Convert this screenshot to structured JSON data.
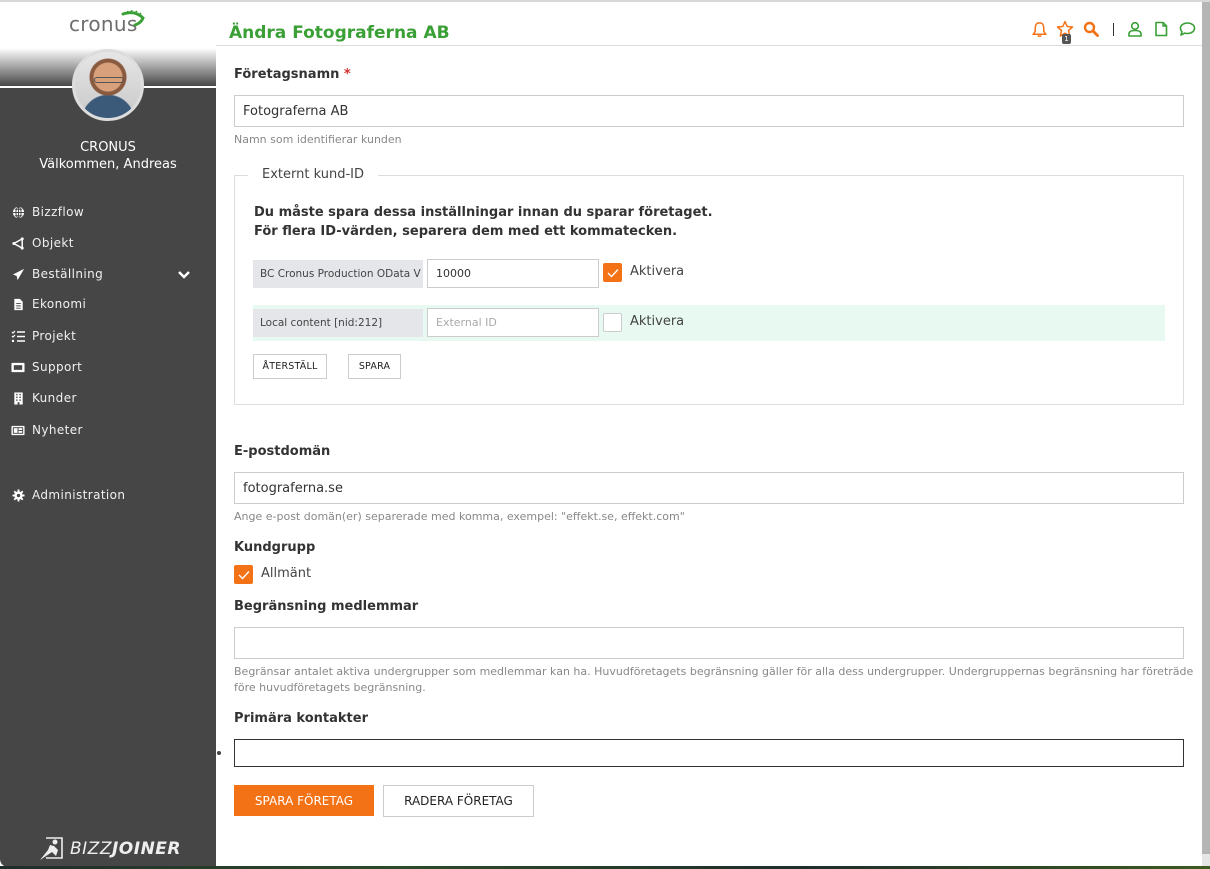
{
  "brand": {
    "logo_text": "cronus",
    "footer_logo_prefix": "BIZZ",
    "footer_logo_suffix": "JOINER"
  },
  "user": {
    "organization": "CRONUS",
    "welcome": "Välkommen, Andreas"
  },
  "sidebar": {
    "items": [
      {
        "label": "Bizzflow",
        "icon": "globe-icon"
      },
      {
        "label": "Objekt",
        "icon": "objects-icon"
      },
      {
        "label": "Beställning",
        "icon": "paper-plane-icon",
        "expandable": true
      },
      {
        "label": "Ekonomi",
        "icon": "document-icon"
      },
      {
        "label": "Projekt",
        "icon": "tasks-icon"
      },
      {
        "label": "Support",
        "icon": "ticket-icon"
      },
      {
        "label": "Kunder",
        "icon": "building-icon"
      },
      {
        "label": "Nyheter",
        "icon": "newspaper-icon"
      },
      {
        "label": "Administration",
        "icon": "gear-icon"
      }
    ]
  },
  "header": {
    "title": "Ändra Fotograferna AB",
    "favorites_badge": "1",
    "icons": [
      "bell-icon",
      "star-icon",
      "search-icon",
      "user-icon",
      "file-icon",
      "chat-icon"
    ],
    "accent_orange": "#f47216",
    "accent_green": "#3aa036"
  },
  "form": {
    "company_name": {
      "label": "Företagsnamn",
      "required_mark": "*",
      "value": "Fotograferna AB",
      "help": "Namn som identifierar kunden"
    },
    "external_id": {
      "legend": "Externt kund-ID",
      "note_line1": "Du måste spara dessa inställningar innan du sparar företaget.",
      "note_line2": "För flera ID-värden, separera dem med ett kommatecken.",
      "rows": [
        {
          "source": "BC Cronus Production OData V",
          "value": "10000",
          "placeholder": "",
          "activate_label": "Aktivera",
          "active": true
        },
        {
          "source": "Local content [nid:212]",
          "value": "",
          "placeholder": "External ID",
          "activate_label": "Aktivera",
          "active": false
        }
      ],
      "reset_label": "ÅTERSTÄLL",
      "save_label": "SPARA"
    },
    "email_domain": {
      "label": "E-postdomän",
      "value": "fotograferna.se",
      "help": "Ange e-post domän(er) separerade med komma, exempel: \"effekt.se, effekt.com\""
    },
    "customer_group": {
      "label": "Kundgrupp",
      "options": [
        {
          "label": "Allmänt",
          "checked": true
        }
      ]
    },
    "member_limit": {
      "label": "Begränsning medlemmar",
      "value": "",
      "help_line1": "Begränsar antalet aktiva undergrupper som medlemmar kan ha. Huvudföretagets begränsning gäller för alla dess undergrupper. Undergruppernas begränsning har företräde",
      "help_line2": "före huvudföretagets begränsning."
    },
    "primary_contacts": {
      "label": "Primära kontakter",
      "value": ""
    },
    "save_company_label": "SPARA FÖRETAG",
    "delete_company_label": "RADERA FÖRETAG"
  }
}
